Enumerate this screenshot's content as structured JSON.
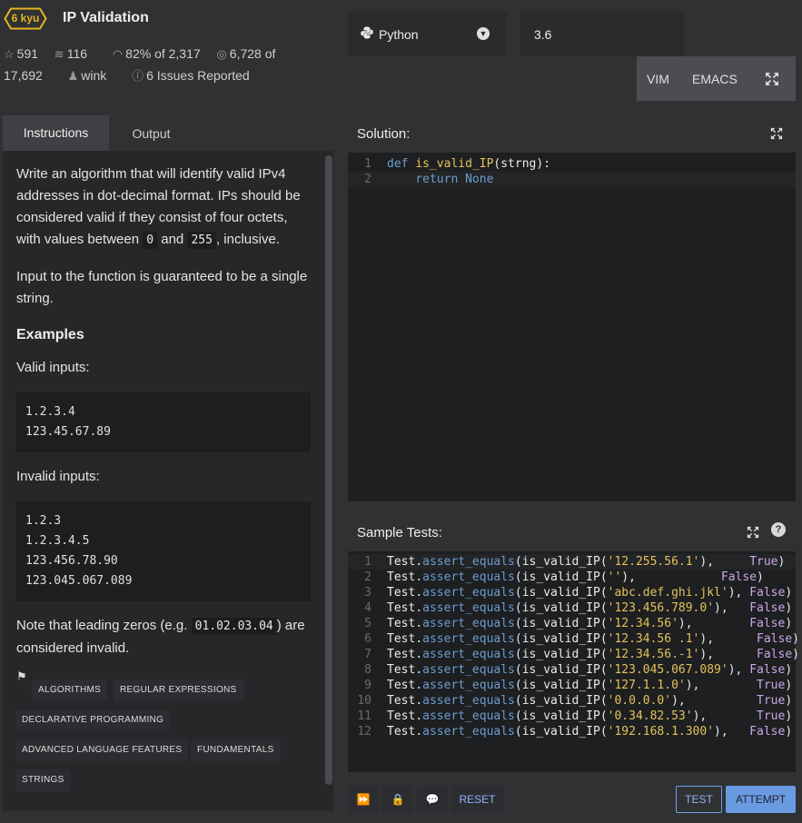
{
  "kata": {
    "rank": "6 kyu",
    "title": "IP Validation",
    "stats": {
      "stars": "591",
      "collections": "116",
      "satisfaction": "82% of 2,317",
      "completed": "6,728 of",
      "completed_total": "17,692",
      "author": "wink",
      "issues": "6 Issues Reported"
    }
  },
  "editor_settings": {
    "language": "Python",
    "version": "3.6",
    "modes": [
      "VIM",
      "EMACS"
    ]
  },
  "tabs": [
    "Instructions",
    "Output"
  ],
  "description": {
    "p1_a": "Write an algorithm that will identify valid IPv4 addresses in dot-decimal format. IPs should be considered valid if they consist of four octets, with values between ",
    "p1_code1": "0",
    "p1_and": " and ",
    "p1_code2": "255",
    "p1_b": ", inclusive.",
    "p2": "Input to the function is guaranteed to be a single string.",
    "examples_heading": "Examples",
    "valid_label": "Valid inputs:",
    "valid_inputs": [
      "1.2.3.4",
      "123.45.67.89"
    ],
    "invalid_label": "Invalid inputs:",
    "invalid_inputs": [
      "1.2.3",
      "1.2.3.4.5",
      "123.456.78.90",
      "123.045.067.089"
    ],
    "note_a": "Note that leading zeros (e.g. ",
    "note_code": "01.02.03.04",
    "note_b": ") are considered invalid."
  },
  "tags": [
    "ALGORITHMS",
    "REGULAR EXPRESSIONS",
    "DECLARATIVE PROGRAMMING",
    "ADVANCED LANGUAGE FEATURES",
    "FUNDAMENTALS",
    "STRINGS"
  ],
  "solution": {
    "title": "Solution:",
    "line_numbers": [
      "1",
      "2"
    ],
    "kw_def": "def",
    "fn_name": "is_valid_IP",
    "params": "(strng):",
    "kw_return": "return",
    "ret_value": "None"
  },
  "sample_tests": {
    "title": "Sample Tests:",
    "help": "?",
    "obj": "Test",
    "method": "assert_equals",
    "fn": "is_valid_IP",
    "lines": [
      {
        "n": "1",
        "arg": "'12.255.56.1'",
        "pad": "     ",
        "expected": "True"
      },
      {
        "n": "2",
        "arg": "''",
        "pad": "            ",
        "expected": "False"
      },
      {
        "n": "3",
        "arg": "'abc.def.ghi.jkl'",
        "pad": " ",
        "expected": "False"
      },
      {
        "n": "4",
        "arg": "'123.456.789.0'",
        "pad": "   ",
        "expected": "False"
      },
      {
        "n": "5",
        "arg": "'12.34.56'",
        "pad": "        ",
        "expected": "False"
      },
      {
        "n": "6",
        "arg": "'12.34.56 .1'",
        "pad": "      ",
        "expected": "False"
      },
      {
        "n": "7",
        "arg": "'12.34.56.-1'",
        "pad": "      ",
        "expected": "False"
      },
      {
        "n": "8",
        "arg": "'123.045.067.089'",
        "pad": " ",
        "expected": "False"
      },
      {
        "n": "9",
        "arg": "'127.1.1.0'",
        "pad": "        ",
        "expected": "True"
      },
      {
        "n": "10",
        "arg": "'0.0.0.0'",
        "pad": "          ",
        "expected": "True"
      },
      {
        "n": "11",
        "arg": "'0.34.82.53'",
        "pad": "       ",
        "expected": "True"
      },
      {
        "n": "12",
        "arg": "'192.168.1.300'",
        "pad": "   ",
        "expected": "False"
      }
    ]
  },
  "actions": {
    "reset": "RESET",
    "test": "TEST",
    "attempt": "ATTEMPT"
  },
  "colors": {
    "rank_badge": "#e6b422",
    "accent_blue": "#6a9ae0",
    "string": "#e3c25a",
    "keyword": "#6a9dcf",
    "boolean": "#c9a7e8"
  }
}
